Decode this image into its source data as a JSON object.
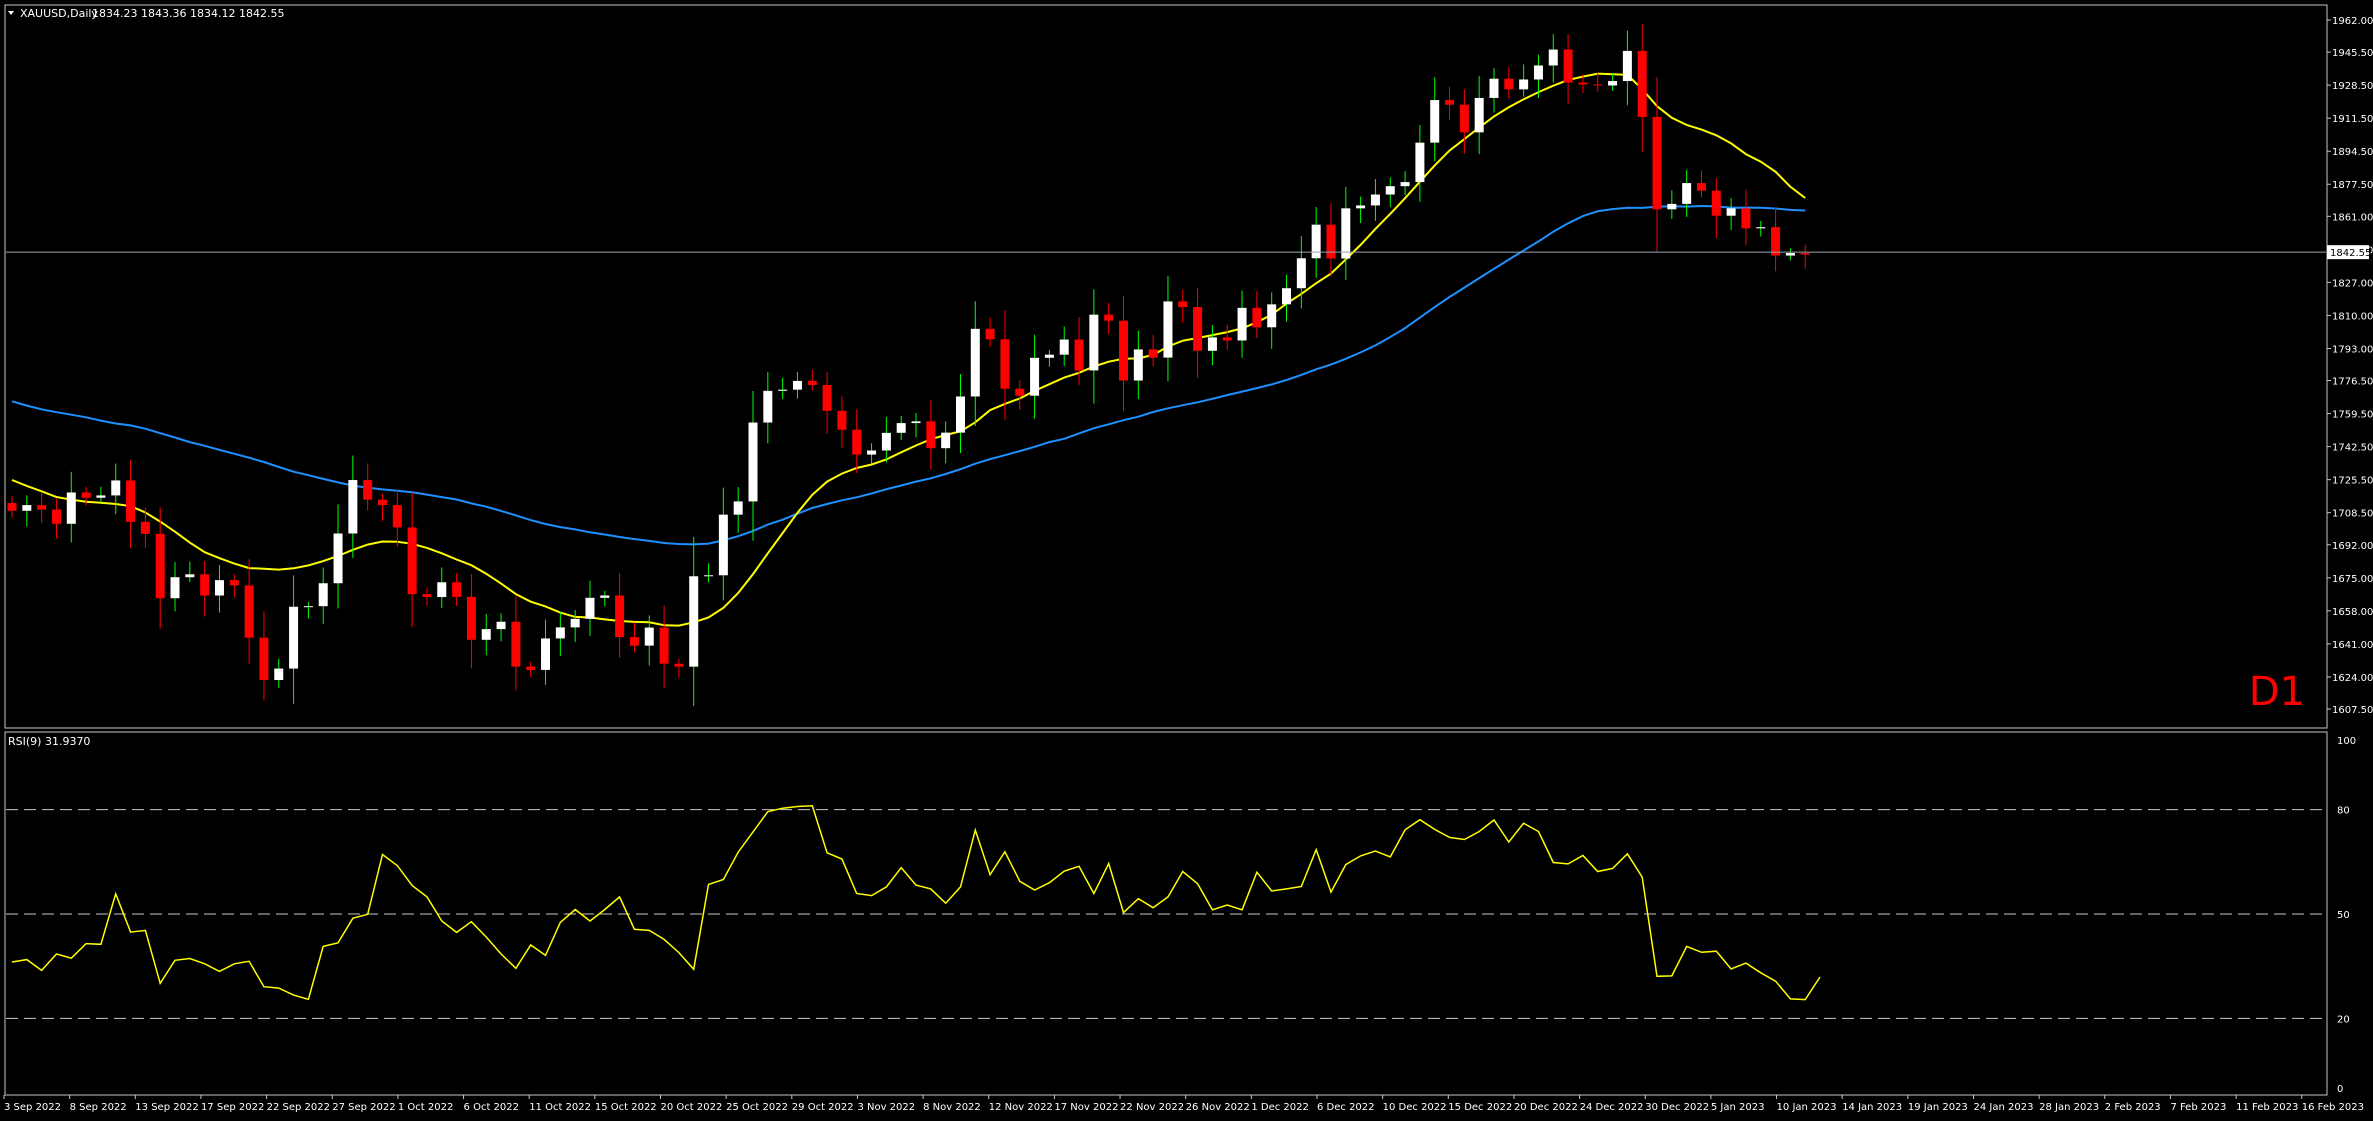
{
  "header": {
    "symbol_label": "XAUUSD,Daily",
    "ohlc_label": "1834.23 1843.36 1834.12 1842.55"
  },
  "timeframe_label": "D1",
  "price_panel": {
    "current_price_label": "1842.55",
    "y_tick_labels": [
      "1962.00",
      "1945.50",
      "1928.50",
      "1911.50",
      "1894.50",
      "1877.50",
      "1861.00",
      "1844.00",
      "1827.00",
      "1810.00",
      "1793.00",
      "1776.50",
      "1759.50",
      "1742.50",
      "1725.50",
      "1708.50",
      "1692.00",
      "1675.00",
      "1658.00",
      "1641.00",
      "1624.00",
      "1607.50"
    ]
  },
  "rsi_panel": {
    "label": "RSI(9) 31.9370",
    "y_tick_labels": [
      "100",
      "80",
      "50",
      "20",
      "0"
    ]
  },
  "x_tick_labels": [
    "3 Sep 2022",
    "8 Sep 2022",
    "13 Sep 2022",
    "17 Sep 2022",
    "22 Sep 2022",
    "27 Sep 2022",
    "1 Oct 2022",
    "6 Oct 2022",
    "11 Oct 2022",
    "15 Oct 2022",
    "20 Oct 2022",
    "25 Oct 2022",
    "29 Oct 2022",
    "3 Nov 2022",
    "8 Nov 2022",
    "12 Nov 2022",
    "17 Nov 2022",
    "22 Nov 2022",
    "26 Nov 2022",
    "1 Dec 2022",
    "6 Dec 2022",
    "10 Dec 2022",
    "15 Dec 2022",
    "20 Dec 2022",
    "24 Dec 2022",
    "30 Dec 2022",
    "5 Jan 2023",
    "10 Jan 2023",
    "14 Jan 2023",
    "19 Jan 2023",
    "24 Jan 2023",
    "28 Jan 2023",
    "2 Feb 2023",
    "7 Feb 2023",
    "11 Feb 2023",
    "16 Feb 2023"
  ],
  "colors": {
    "background": "#000000",
    "bull_candle": "#FFFFFF",
    "bear_candle": "#FF0000",
    "bull_wick": "#00FF00",
    "ma_fast": "#FFFF00",
    "ma_slow": "#1E90FF",
    "rsi_line": "#FFFF00",
    "grid": "#C8C8C8"
  },
  "chart_data": {
    "type": "candlestick",
    "symbol": "XAUUSD",
    "timeframe": "D1",
    "ohlc_last": {
      "open": 1834.23,
      "high": 1843.36,
      "low": 1834.12,
      "close": 1842.55
    },
    "price_ylim": [
      1607.5,
      1962.0
    ],
    "rsi_ylim": [
      0,
      100
    ],
    "rsi_levels": [
      20,
      50,
      80
    ],
    "rsi_period": 9,
    "rsi_last": 31.937,
    "x": [
      "1 Sep 2022",
      "2 Sep 2022",
      "5 Sep 2022",
      "6 Sep 2022",
      "7 Sep 2022",
      "8 Sep 2022",
      "9 Sep 2022",
      "12 Sep 2022",
      "13 Sep 2022",
      "14 Sep 2022",
      "15 Sep 2022",
      "16 Sep 2022",
      "19 Sep 2022",
      "20 Sep 2022",
      "21 Sep 2022",
      "22 Sep 2022",
      "23 Sep 2022",
      "26 Sep 2022",
      "27 Sep 2022",
      "28 Sep 2022",
      "29 Sep 2022",
      "30 Sep 2022",
      "3 Oct 2022",
      "4 Oct 2022",
      "5 Oct 2022",
      "6 Oct 2022",
      "7 Oct 2022",
      "10 Oct 2022",
      "11 Oct 2022",
      "12 Oct 2022",
      "13 Oct 2022",
      "14 Oct 2022",
      "17 Oct 2022",
      "18 Oct 2022",
      "19 Oct 2022",
      "20 Oct 2022",
      "21 Oct 2022",
      "24 Oct 2022",
      "25 Oct 2022",
      "26 Oct 2022",
      "27 Oct 2022",
      "28 Oct 2022",
      "31 Oct 2022",
      "1 Nov 2022",
      "2 Nov 2022",
      "3 Nov 2022",
      "4 Nov 2022",
      "7 Nov 2022",
      "8 Nov 2022",
      "9 Nov 2022",
      "10 Nov 2022",
      "11 Nov 2022",
      "14 Nov 2022",
      "15 Nov 2022",
      "16 Nov 2022",
      "17 Nov 2022",
      "18 Nov 2022",
      "21 Nov 2022",
      "22 Nov 2022",
      "23 Nov 2022",
      "24 Nov 2022",
      "25 Nov 2022",
      "28 Nov 2022",
      "29 Nov 2022",
      "30 Nov 2022",
      "1 Dec 2022",
      "2 Dec 2022",
      "5 Dec 2022",
      "6 Dec 2022",
      "7 Dec 2022",
      "8 Dec 2022",
      "9 Dec 2022",
      "12 Dec 2022",
      "13 Dec 2022",
      "14 Dec 2022",
      "15 Dec 2022",
      "16 Dec 2022",
      "19 Dec 2022",
      "20 Dec 2022",
      "21 Dec 2022",
      "22 Dec 2022",
      "23 Dec 2022",
      "26 Dec 2022",
      "27 Dec 2022",
      "28 Dec 2022",
      "29 Dec 2022",
      "30 Dec 2022",
      "2 Jan 2023",
      "3 Jan 2023",
      "4 Jan 2023",
      "5 Jan 2023",
      "6 Jan 2023",
      "9 Jan 2023",
      "10 Jan 2023",
      "11 Jan 2023",
      "12 Jan 2023",
      "13 Jan 2023",
      "16 Jan 2023",
      "17 Jan 2023",
      "18 Jan 2023",
      "19 Jan 2023",
      "20 Jan 2023",
      "23 Jan 2023",
      "24 Jan 2023",
      "25 Jan 2023",
      "26 Jan 2023",
      "27 Jan 2023",
      "30 Jan 2023",
      "31 Jan 2023",
      "1 Feb 2023",
      "2 Feb 2023",
      "3 Feb 2023",
      "6 Feb 2023",
      "7 Feb 2023",
      "8 Feb 2023",
      "9 Feb 2023",
      "10 Feb 2023",
      "13 Feb 2023",
      "14 Feb 2023",
      "15 Feb 2023",
      "16 Feb 2023",
      "17 Feb 2023",
      "20 Feb 2023"
    ],
    "close": [
      1709.5,
      1712.4,
      1710.1,
      1702.8,
      1718.9,
      1716.2,
      1717.4,
      1725.1,
      1703.8,
      1697.6,
      1664.5,
      1675.3,
      1676.8,
      1665.9,
      1673.8,
      1671.1,
      1644.2,
      1622.4,
      1628.3,
      1660.1,
      1660.4,
      1672.2,
      1697.8,
      1725.3,
      1715.2,
      1712.4,
      1700.9,
      1666.6,
      1665.1,
      1672.7,
      1665.2,
      1643.1,
      1648.6,
      1652.4,
      1629.3,
      1627.6,
      1643.8,
      1649.5,
      1653.9,
      1664.7,
      1665.9,
      1644.5,
      1640.1,
      1649.4,
      1630.8,
      1629.3,
      1675.8,
      1676.3,
      1707.5,
      1714.3,
      1754.9,
      1771.2,
      1771.8,
      1776.3,
      1774.2,
      1760.9,
      1751.2,
      1738.4,
      1740.5,
      1749.6,
      1754.6,
      1755.5,
      1741.7,
      1749.7,
      1768.3,
      1803.1,
      1797.7,
      1772.3,
      1768.7,
      1788.2,
      1789.8,
      1797.6,
      1781.7,
      1810.4,
      1807.3,
      1776.5,
      1792.5,
      1788.3,
      1817.2,
      1814.3,
      1791.8,
      1798.7,
      1797.1,
      1813.9,
      1803.9,
      1815.7,
      1824.0,
      1839.4,
      1856.7,
      1839.3,
      1865.1,
      1866.6,
      1872.2,
      1876.5,
      1878.6,
      1898.9,
      1920.8,
      1918.4,
      1904.2,
      1921.9,
      1931.8,
      1926.3,
      1931.4,
      1938.6,
      1946.8,
      1929.8,
      1928.8,
      1928.3,
      1930.6,
      1946.1,
      1912.1,
      1864.6,
      1867.4,
      1878.1,
      1874.2,
      1861.3,
      1865.1,
      1854.8,
      1855.4,
      1840.8,
      1842.1,
      1841.3
    ],
    "ma_fast": [
      1725.3,
      1722.3,
      1719.5,
      1716.6,
      1715.2,
      1714.1,
      1713.6,
      1713.0,
      1711.9,
      1708.6,
      1703.9,
      1698.7,
      1693.1,
      1688.2,
      1685.1,
      1682.3,
      1680.0,
      1679.7,
      1679.2,
      1679.9,
      1681.4,
      1683.6,
      1686.2,
      1689.4,
      1692.1,
      1693.7,
      1693.6,
      1692.5,
      1690.4,
      1687.6,
      1684.4,
      1681.5,
      1677.1,
      1672.0,
      1666.6,
      1662.7,
      1660.3,
      1657.1,
      1654.9,
      1654.6,
      1653.6,
      1652.8,
      1652.3,
      1652.1,
      1650.6,
      1650.4,
      1652.1,
      1654.6,
      1659.5,
      1667.2,
      1676.9,
      1687.6,
      1698.0,
      1708.5,
      1717.7,
      1724.5,
      1728.6,
      1731.5,
      1733.3,
      1735.9,
      1739.6,
      1743.1,
      1746.3,
      1748.5,
      1750.4,
      1755.0,
      1761.3,
      1764.5,
      1767.3,
      1771.2,
      1774.6,
      1778.0,
      1780.5,
      1783.7,
      1786.2,
      1787.7,
      1787.9,
      1789.7,
      1794.0,
      1797.0,
      1798.4,
      1799.9,
      1801.4,
      1803.3,
      1806.5,
      1810.3,
      1816.1,
      1821.1,
      1826.6,
      1831.5,
      1838.8,
      1846.3,
      1854.5,
      1862.3,
      1870.3,
      1878.8,
      1887.2,
      1894.8,
      1900.7,
      1906.7,
      1912.4,
      1917.1,
      1921.2,
      1924.9,
      1928.2,
      1931.2,
      1932.9,
      1934.4,
      1934.1,
      1933.8,
      1926.4,
      1917.7,
      1911.7,
      1908.0,
      1905.6,
      1902.7,
      1898.5,
      1893.0,
      1889.1,
      1883.9,
      1876.2,
      1870.4
    ],
    "ma_slow": [
      1765.8,
      1763.6,
      1761.7,
      1760.2,
      1758.9,
      1757.6,
      1755.9,
      1754.4,
      1753.4,
      1751.7,
      1749.4,
      1747.2,
      1744.8,
      1742.9,
      1740.8,
      1738.8,
      1736.8,
      1734.6,
      1732.0,
      1729.6,
      1727.8,
      1725.9,
      1724.1,
      1722.4,
      1721.4,
      1720.5,
      1719.8,
      1719.0,
      1717.8,
      1716.5,
      1715.3,
      1713.3,
      1711.6,
      1709.4,
      1707.1,
      1704.7,
      1702.7,
      1701.1,
      1699.9,
      1698.4,
      1697.3,
      1696.0,
      1694.9,
      1694.0,
      1692.9,
      1692.4,
      1692.2,
      1692.6,
      1694.3,
      1696.4,
      1699.1,
      1702.4,
      1704.9,
      1708.0,
      1710.9,
      1713.0,
      1714.9,
      1716.4,
      1718.4,
      1720.6,
      1722.5,
      1724.5,
      1726.2,
      1728.4,
      1730.9,
      1733.7,
      1736.1,
      1738.1,
      1740.2,
      1742.4,
      1744.8,
      1746.5,
      1749.3,
      1752.0,
      1754.0,
      1756.1,
      1757.9,
      1760.3,
      1762.2,
      1763.8,
      1765.3,
      1767.1,
      1769.0,
      1770.8,
      1772.6,
      1774.5,
      1776.8,
      1779.4,
      1782.3,
      1784.7,
      1787.7,
      1791.0,
      1794.6,
      1798.9,
      1803.5,
      1808.9,
      1814.3,
      1819.5,
      1824.3,
      1829.2,
      1834.0,
      1838.7,
      1843.4,
      1848.1,
      1853.1,
      1857.4,
      1861.1,
      1863.6,
      1864.7,
      1865.4,
      1865.3,
      1865.9,
      1866.2,
      1866.0,
      1866.3,
      1866.1,
      1865.4,
      1865.5,
      1865.4,
      1865.0,
      1864.3,
      1864.0
    ],
    "rsi": [
      36.2,
      36.9,
      33.8,
      38.5,
      37.3,
      41.5,
      41.3,
      55.8,
      44.8,
      45.3,
      30.1,
      36.7,
      37.2,
      35.7,
      33.5,
      35.7,
      36.4,
      29.1,
      28.7,
      26.7,
      25.5,
      40.7,
      41.7,
      48.8,
      49.9,
      67.1,
      63.9,
      58.2,
      54.9,
      48.0,
      44.7,
      47.8,
      43.4,
      38.5,
      34.4,
      41.1,
      38.1,
      47.6,
      51.3,
      48.0,
      51.3,
      54.9,
      45.6,
      45.3,
      42.7,
      38.9,
      34.1,
      58.5,
      59.9,
      67.8,
      73.6,
      79.4,
      80.4,
      80.9,
      81.1,
      67.6,
      65.8,
      55.9,
      55.3,
      57.8,
      63.3,
      58.3,
      57.2,
      53.1,
      57.8,
      74.1,
      61.3,
      67.9,
      59.4,
      56.9,
      59.0,
      62.3,
      63.7,
      55.9,
      64.5,
      50.4,
      54.4,
      51.8,
      54.9,
      62.2,
      58.7,
      51.2,
      52.6,
      51.2,
      62.0,
      56.6,
      57.2,
      57.9,
      68.5,
      56.3,
      64.2,
      66.7,
      68.1,
      66.4,
      74.2,
      77.1,
      74.3,
      72.0,
      71.4,
      73.7,
      77.0,
      70.7,
      76.1,
      73.7,
      64.8,
      64.4,
      66.8,
      62.2,
      63.1,
      67.3,
      60.6,
      32.1,
      32.2,
      40.7,
      39.0,
      39.3,
      34.2,
      35.9,
      33.1,
      30.7,
      25.6,
      25.4,
      31.9
    ]
  }
}
